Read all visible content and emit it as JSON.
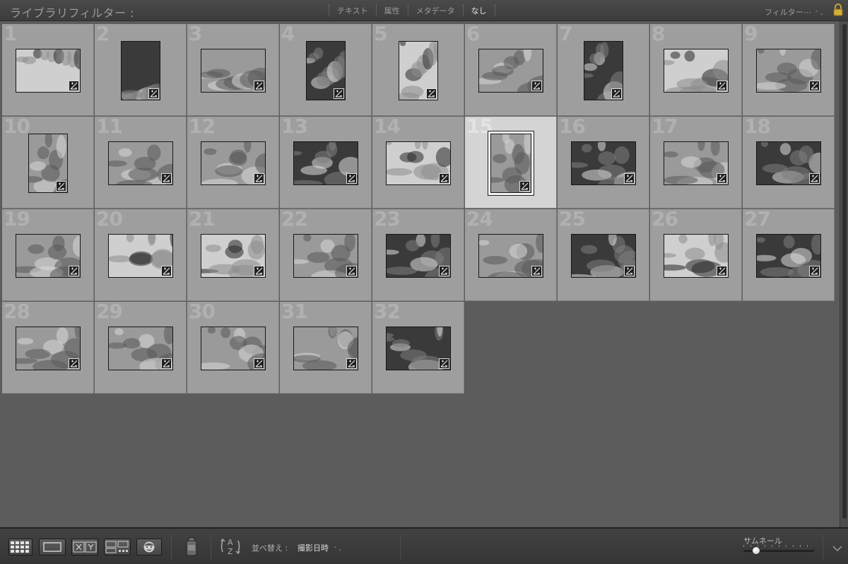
{
  "filter_bar": {
    "title": "ライブラリフィルター :",
    "tabs": [
      {
        "label": "テキスト",
        "active": false
      },
      {
        "label": "属性",
        "active": false
      },
      {
        "label": "メタデータ",
        "active": false
      },
      {
        "label": "なし",
        "active": true
      }
    ],
    "preset_label": "フィルター⋯",
    "preset_arrows": "⌃⌄"
  },
  "photos": [
    {
      "number": "1",
      "orientation": "landscape",
      "tone": "light",
      "selected": false
    },
    {
      "number": "2",
      "orientation": "portrait",
      "tone": "dark",
      "selected": false
    },
    {
      "number": "3",
      "orientation": "landscape",
      "tone": "mid",
      "selected": false
    },
    {
      "number": "4",
      "orientation": "portrait",
      "tone": "dark",
      "selected": false
    },
    {
      "number": "5",
      "orientation": "portrait",
      "tone": "light",
      "selected": false
    },
    {
      "number": "6",
      "orientation": "landscape",
      "tone": "mid",
      "selected": false
    },
    {
      "number": "7",
      "orientation": "portrait",
      "tone": "dark",
      "selected": false
    },
    {
      "number": "8",
      "orientation": "landscape",
      "tone": "light",
      "selected": false
    },
    {
      "number": "9",
      "orientation": "landscape",
      "tone": "mid",
      "selected": false
    },
    {
      "number": "10",
      "orientation": "portrait",
      "tone": "mid",
      "selected": false
    },
    {
      "number": "11",
      "orientation": "landscape",
      "tone": "mid",
      "selected": false
    },
    {
      "number": "12",
      "orientation": "landscape",
      "tone": "mid",
      "selected": false
    },
    {
      "number": "13",
      "orientation": "landscape",
      "tone": "dark",
      "selected": false
    },
    {
      "number": "14",
      "orientation": "landscape",
      "tone": "light",
      "selected": false
    },
    {
      "number": "15",
      "orientation": "portrait",
      "tone": "mid",
      "selected": true
    },
    {
      "number": "16",
      "orientation": "landscape",
      "tone": "dark",
      "selected": false
    },
    {
      "number": "17",
      "orientation": "landscape",
      "tone": "mid",
      "selected": false
    },
    {
      "number": "18",
      "orientation": "landscape",
      "tone": "dark",
      "selected": false
    },
    {
      "number": "19",
      "orientation": "landscape",
      "tone": "mid",
      "selected": false
    },
    {
      "number": "20",
      "orientation": "landscape",
      "tone": "light",
      "selected": false
    },
    {
      "number": "21",
      "orientation": "landscape",
      "tone": "light",
      "selected": false
    },
    {
      "number": "22",
      "orientation": "landscape",
      "tone": "mid",
      "selected": false
    },
    {
      "number": "23",
      "orientation": "landscape",
      "tone": "dark",
      "selected": false
    },
    {
      "number": "24",
      "orientation": "landscape",
      "tone": "mid",
      "selected": false
    },
    {
      "number": "25",
      "orientation": "landscape",
      "tone": "dark",
      "selected": false
    },
    {
      "number": "26",
      "orientation": "landscape",
      "tone": "light",
      "selected": false
    },
    {
      "number": "27",
      "orientation": "landscape",
      "tone": "dark",
      "selected": false
    },
    {
      "number": "28",
      "orientation": "landscape",
      "tone": "mid",
      "selected": false
    },
    {
      "number": "29",
      "orientation": "landscape",
      "tone": "mid",
      "selected": false
    },
    {
      "number": "30",
      "orientation": "landscape",
      "tone": "mid",
      "selected": false
    },
    {
      "number": "31",
      "orientation": "landscape",
      "tone": "mid",
      "selected": false
    },
    {
      "number": "32",
      "orientation": "landscape",
      "tone": "dark",
      "selected": false
    }
  ],
  "toolbar": {
    "sort_label": "並べ替え :",
    "sort_value": "撮影日時",
    "sort_arrows": "⌃⌄",
    "thumbnail_label": "サムネール",
    "thumbnail_size_fraction": 0.18
  },
  "colors": {
    "cell": "#9e9e9e",
    "cell_selected": "#d4d4d4",
    "background": "#5c5c5c"
  }
}
